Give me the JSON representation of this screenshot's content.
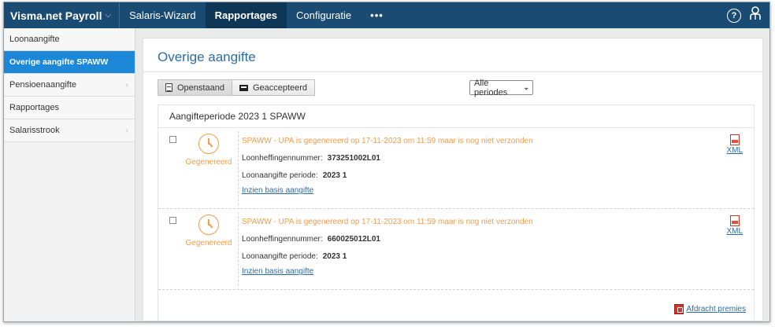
{
  "topnav": {
    "brand": "Visma.net Payroll",
    "items": [
      {
        "label": "Salaris-Wizard"
      },
      {
        "label": "Rapportages"
      },
      {
        "label": "Configuratie"
      },
      {
        "label": "•••"
      }
    ],
    "help_icon": "question-icon",
    "user_icon": "user-icon",
    "accent": "#1a4b73"
  },
  "sidebar": {
    "items": [
      {
        "label": "Loonaangifte",
        "chevron": false
      },
      {
        "label": "Overige aangifte SPAWW",
        "chevron": false,
        "active": true
      },
      {
        "label": "Pensioenaangifte",
        "chevron": true
      },
      {
        "label": "Rapportages",
        "chevron": false
      },
      {
        "label": "Salarisstrook",
        "chevron": true
      }
    ]
  },
  "main": {
    "title": "Overige aangifte",
    "tabs": [
      {
        "label": "Openstaand",
        "icon": "document-icon"
      },
      {
        "label": "Geaccepteerd",
        "icon": "inbox-icon"
      }
    ],
    "period_select": {
      "value": "Alle periodes"
    },
    "panel_header": "Aangifteperiode 2023 1 SPAWW",
    "entries": [
      {
        "status": "Gegenereerd",
        "message": "SPAWW - UPA is gegenereerd op 17-11-2023 om 11:59 maar is nog niet verzonden",
        "lhn_label": "Loonheffingennummer:",
        "lhn_value": "373251002L01",
        "period_label": "Loonaangifte periode:",
        "period_value": "2023 1",
        "link": "Inzien basis aangifte",
        "xml": "XML"
      },
      {
        "status": "Gegenereerd",
        "message": "SPAWW - UPA is gegenereerd op 17-11-2023 om 11:59 maar is nog niet verzonden",
        "lhn_label": "Loonheffingennummer:",
        "lhn_value": "660025012L01",
        "period_label": "Loonaangifte periode:",
        "period_value": "2023 1",
        "link": "Inzien basis aangifte",
        "xml": "XML"
      }
    ],
    "footer_link": "Afdracht premies"
  },
  "colors": {
    "status_orange": "#f39c4a",
    "link_blue": "#2e6da4",
    "sidebar_active": "#1e88d8"
  }
}
